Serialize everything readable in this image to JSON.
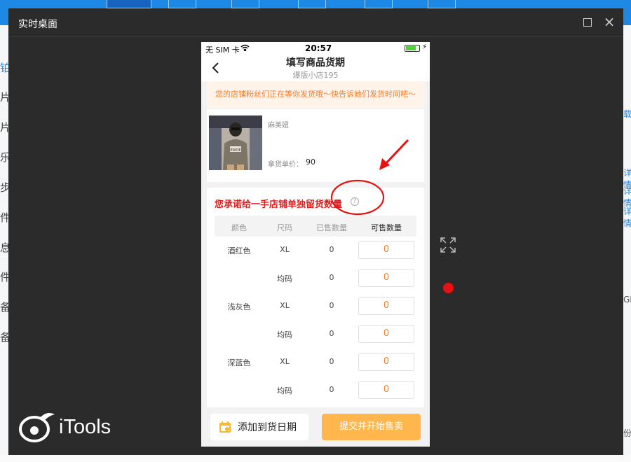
{
  "window": {
    "title": "实时桌面"
  },
  "background": {
    "left_chars": [
      "铂",
      "片",
      "片",
      "乐",
      "步",
      "件",
      "息",
      "件",
      "备",
      "备"
    ],
    "right_chars": [
      "载",
      "详情",
      "详情",
      "详情",
      "GB",
      "份"
    ]
  },
  "branding": {
    "logo_text": "iTools"
  },
  "phone": {
    "status": {
      "carrier": "无 SIM 卡",
      "time": "20:57"
    },
    "nav": {
      "title": "填写商品货期",
      "subtitle": "爆版小店195"
    },
    "notice": "您的店铺粉丝们正在等你发货哦～快告诉她们发货时间吧～",
    "product": {
      "name": "麻美妞",
      "price_label": "拿货单价：",
      "price_value": "90",
      "image_print": "EWOE"
    },
    "commit": {
      "title": "您承诺给一手店铺单独留货数量",
      "help_symbol": "?",
      "headers": [
        "颜色",
        "尺码",
        "已售数量",
        "可售数量"
      ],
      "rows": [
        {
          "color": "酒红色",
          "size": "XL",
          "sold": "0",
          "available": "0"
        },
        {
          "color": "",
          "size": "均码",
          "sold": "0",
          "available": "0"
        },
        {
          "color": "浅灰色",
          "size": "XL",
          "sold": "0",
          "available": "0"
        },
        {
          "color": "",
          "size": "均码",
          "sold": "0",
          "available": "0"
        },
        {
          "color": "深蓝色",
          "size": "XL",
          "sold": "0",
          "available": "0"
        },
        {
          "color": "",
          "size": "均码",
          "sold": "0",
          "available": "0"
        }
      ]
    },
    "actions": {
      "add_date": "添加到货日期",
      "submit": "提交并开始售卖"
    }
  },
  "colors": {
    "accent_red": "#e02020",
    "notice_orange": "#f57c2b",
    "submit_bg": "#ffb74d",
    "window_bg": "#2b2b2b",
    "record_dot": "#e81010"
  }
}
